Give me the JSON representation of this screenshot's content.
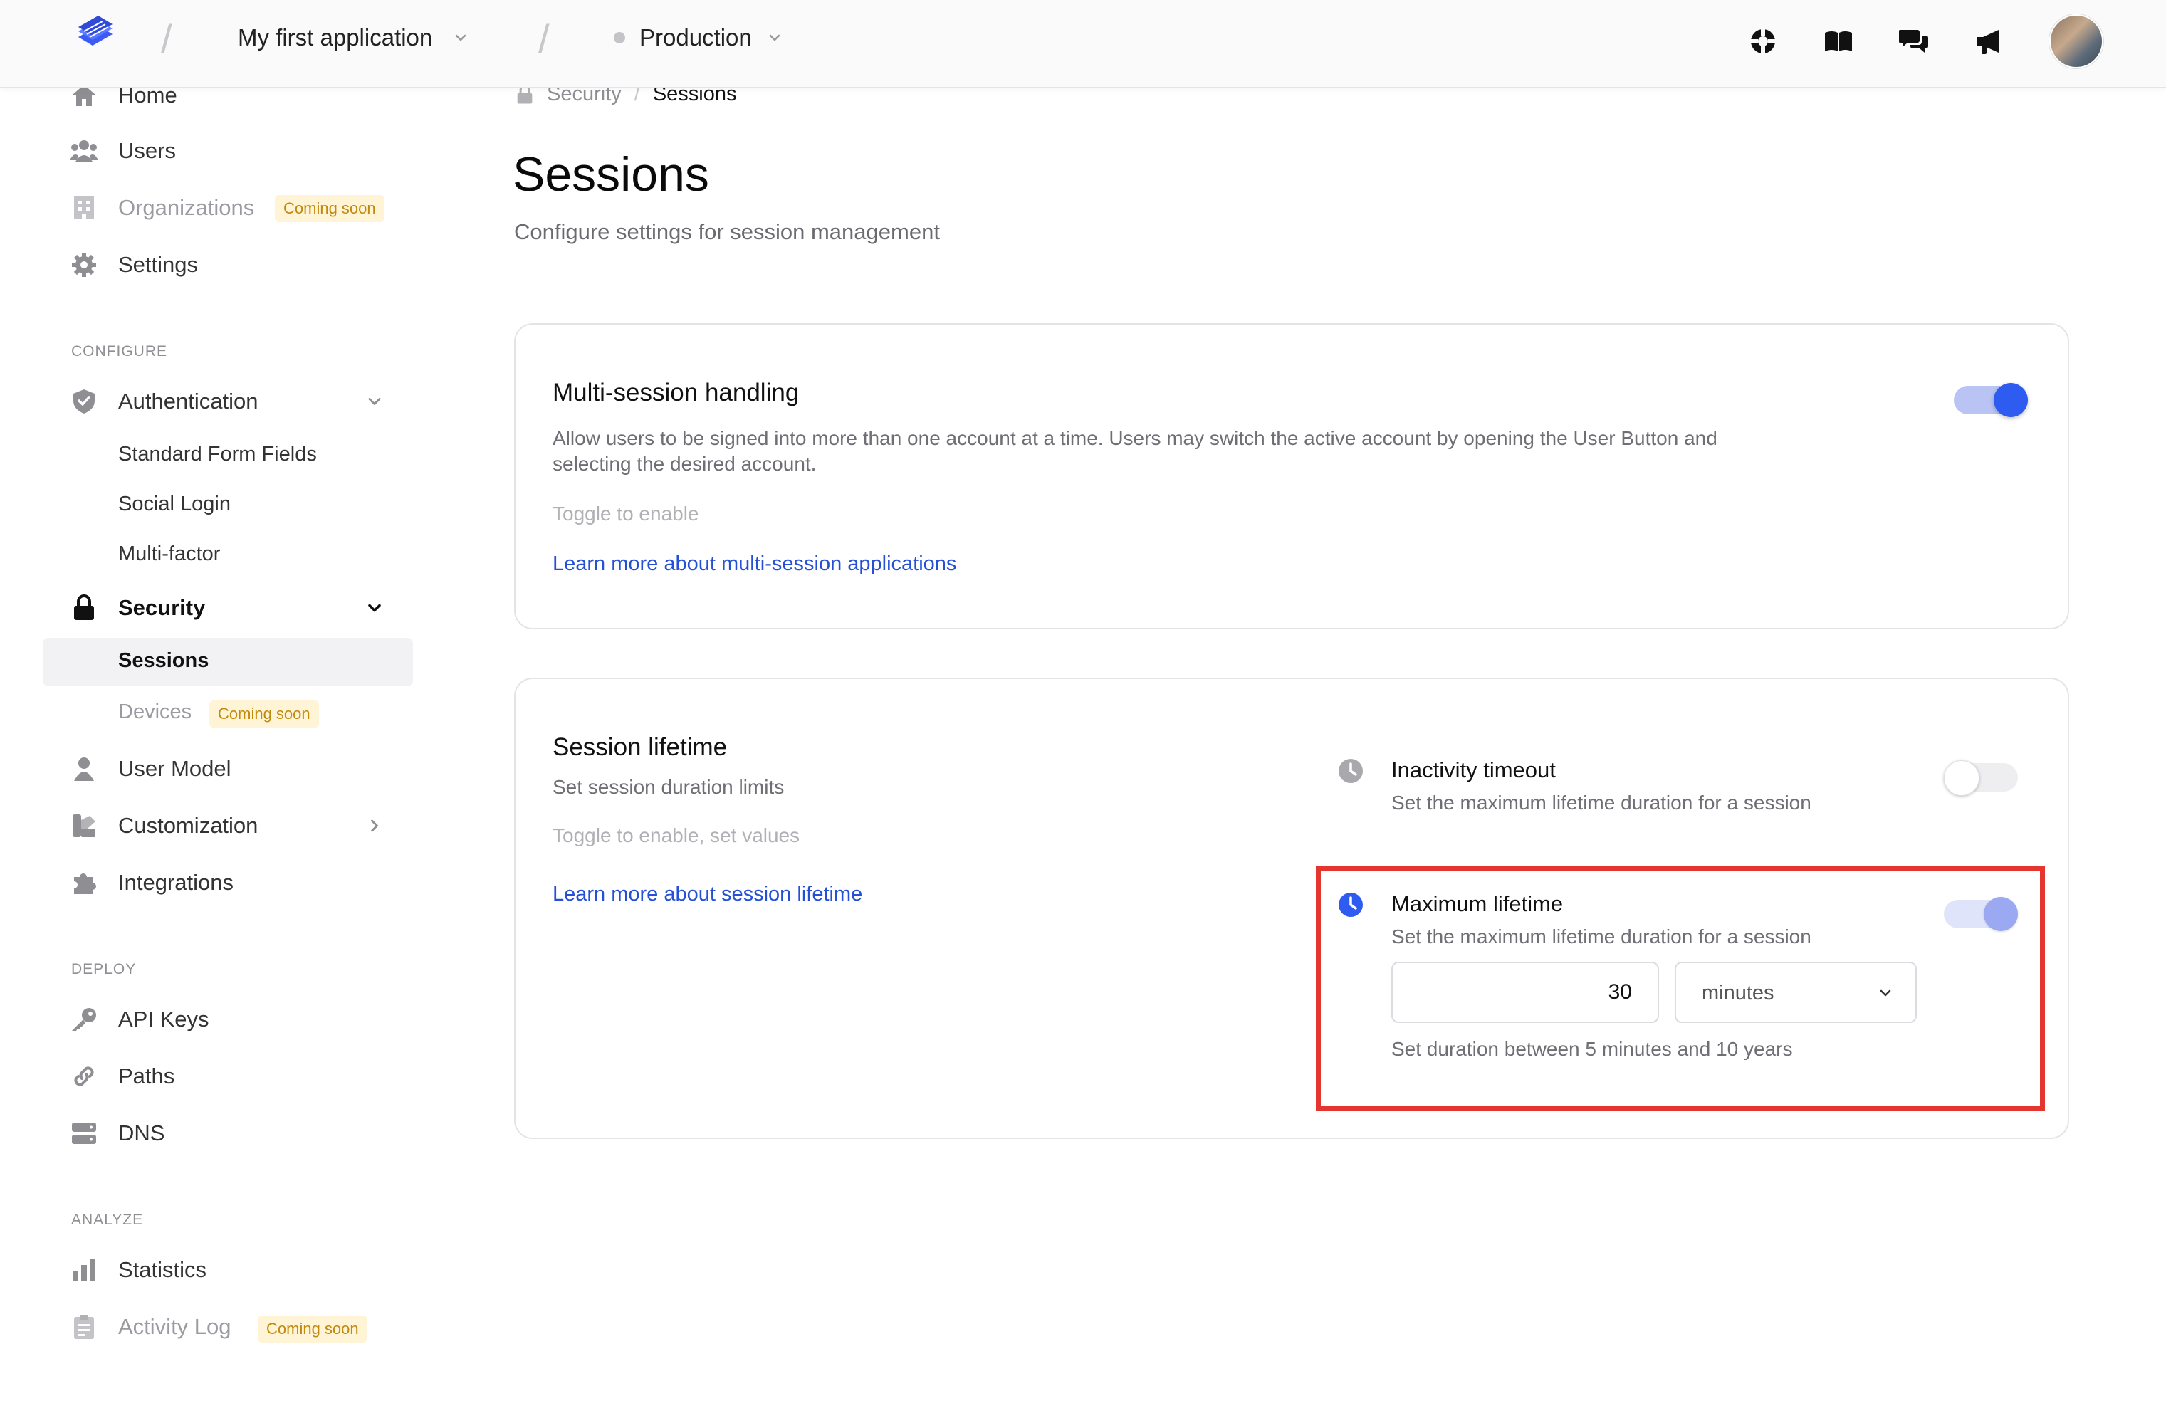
{
  "header": {
    "app_name": "My first application",
    "environment": "Production",
    "icons": [
      "support-icon",
      "docs-book-icon",
      "chat-bubbles-icon",
      "megaphone-icon"
    ]
  },
  "sidebar": {
    "items_top": [
      {
        "label": "Home",
        "icon": "home-icon"
      },
      {
        "label": "Users",
        "icon": "users-icon"
      },
      {
        "label": "Organizations",
        "icon": "building-icon",
        "badge": "Coming soon"
      },
      {
        "label": "Settings",
        "icon": "gear-icon"
      }
    ],
    "section_configure": "CONFIGURE",
    "authentication": {
      "label": "Authentication",
      "children": [
        "Standard Form Fields",
        "Social Login",
        "Multi-factor"
      ]
    },
    "security": {
      "label": "Security",
      "children": [
        "Sessions",
        "Devices"
      ],
      "devices_badge": "Coming soon"
    },
    "user_model": "User Model",
    "customization": "Customization",
    "integrations": "Integrations",
    "section_deploy": "DEPLOY",
    "deploy_items": [
      "API Keys",
      "Paths",
      "DNS"
    ],
    "section_analyze": "ANALYZE",
    "analyze_items": [
      "Statistics",
      "Activity Log"
    ],
    "activity_badge": "Coming soon"
  },
  "breadcrumb": {
    "parent": "Security",
    "sep": "/",
    "current": "Sessions"
  },
  "page": {
    "title": "Sessions",
    "subtitle": "Configure settings for session management"
  },
  "multi_session": {
    "title": "Multi-session handling",
    "description_line1": "Allow users to be signed into more than one account at a time. Users may switch the active account by opening the User Button and",
    "description_line2": "selecting the desired account.",
    "hint": "Toggle to enable",
    "link": "Learn more about multi-session applications",
    "enabled": true
  },
  "session_lifetime": {
    "title": "Session lifetime",
    "subtitle": "Set session duration limits",
    "hint": "Toggle to enable, set values",
    "link": "Learn more about session lifetime",
    "inactivity": {
      "title": "Inactivity timeout",
      "description": "Set the maximum lifetime duration for a session",
      "enabled": false
    },
    "maximum": {
      "title": "Maximum lifetime",
      "description": "Set the maximum lifetime duration for a session",
      "enabled": true,
      "value": "30",
      "unit": "minutes",
      "help": "Set duration between 5 minutes and 10 years"
    }
  },
  "colors": {
    "accent": "#2e5bf0",
    "link": "#2550d6",
    "highlight": "#e5352f",
    "badge_bg": "#fff4d6",
    "badge_text": "#c28a0c"
  }
}
